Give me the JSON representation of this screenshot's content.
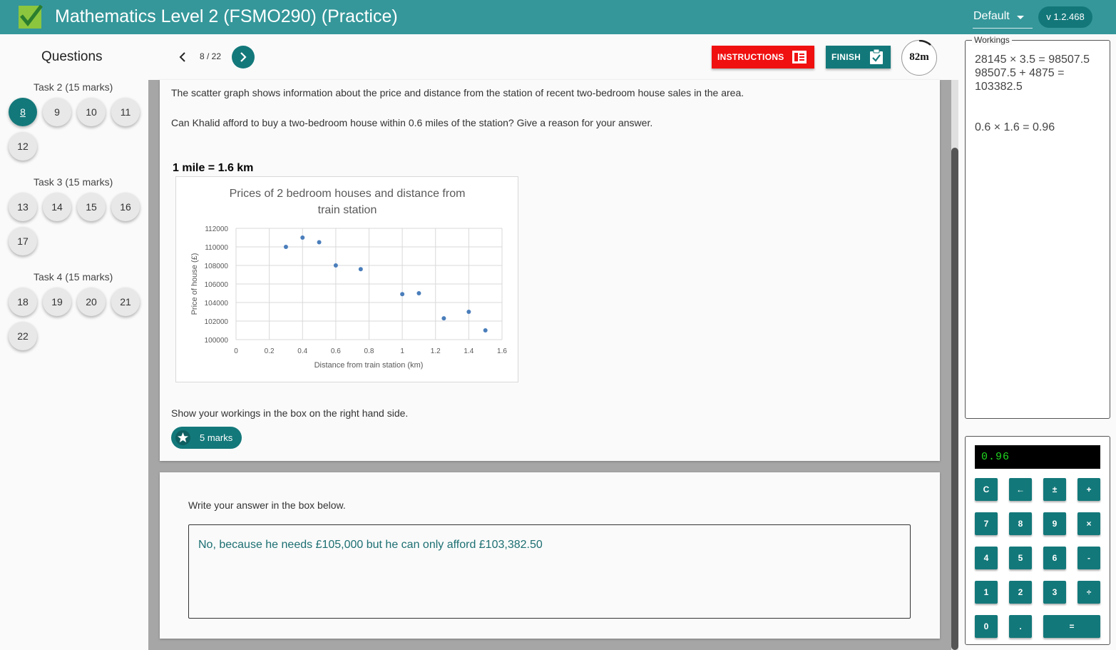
{
  "header": {
    "title": "Mathematics Level 2 (FSMO290) (Practice)",
    "theme": "Default",
    "version": "v 1.2.468"
  },
  "sidebar": {
    "title": "Questions",
    "tasks": [
      {
        "label": "Task 2 (15 marks)",
        "questions": [
          "8",
          "9",
          "10",
          "11",
          "12"
        ]
      },
      {
        "label": "Task 3 (15 marks)",
        "questions": [
          "13",
          "14",
          "15",
          "16",
          "17"
        ]
      },
      {
        "label": "Task 4 (15 marks)",
        "questions": [
          "18",
          "19",
          "20",
          "21",
          "22"
        ]
      }
    ],
    "active_question": "8"
  },
  "nav": {
    "count": "8 / 22",
    "instructions_label": "INSTRUCTIONS",
    "finish_label": "FINISH",
    "timer": "82m"
  },
  "question": {
    "intro": "The scatter graph shows information about the price and distance from the station of recent two-bedroom house sales in the area.",
    "prompt": "Can Khalid afford to buy a two-bedroom house within 0.6 miles of the station? Give a reason for your answer.",
    "conversion_note": "1 mile = 1.6 km",
    "workings_instruction": "Show your workings in the box on the right hand side.",
    "marks": "5 marks"
  },
  "chart_data": {
    "type": "scatter",
    "title": "Prices of 2 bedroom houses and distance from train station",
    "title_lines": [
      "Prices of 2 bedroom houses and distance from",
      "train station"
    ],
    "xlabel": "Distance from train station (km)",
    "ylabel": "Price of house (£)",
    "xlim": [
      0,
      1.6
    ],
    "ylim": [
      100000,
      112000
    ],
    "x_ticks": [
      "0",
      "0.2",
      "0.4",
      "0.6",
      "0.8",
      "1",
      "1.2",
      "1.4",
      "1.6"
    ],
    "y_ticks": [
      "100000",
      "102000",
      "104000",
      "106000",
      "108000",
      "110000",
      "112000"
    ],
    "grid": true,
    "color": "#4a7ebb",
    "points": [
      {
        "x": 0.3,
        "y": 110000
      },
      {
        "x": 0.4,
        "y": 111000
      },
      {
        "x": 0.5,
        "y": 110500
      },
      {
        "x": 0.6,
        "y": 108000
      },
      {
        "x": 0.75,
        "y": 107600
      },
      {
        "x": 1.0,
        "y": 104900
      },
      {
        "x": 1.1,
        "y": 105000
      },
      {
        "x": 1.25,
        "y": 102300
      },
      {
        "x": 1.4,
        "y": 103000
      },
      {
        "x": 1.5,
        "y": 101000
      }
    ]
  },
  "answer": {
    "instruction": "Write your answer in the box below.",
    "text": "No, because he needs £105,000 but he can only afford £103,382.50"
  },
  "workings": {
    "legend": "Workings",
    "lines": [
      "28145 × 3.5 = 98507.5",
      "98507.5 + 4875 =",
      "103382.5",
      "0.6 × 1.6 = 0.96"
    ]
  },
  "calculator": {
    "display": "0.96",
    "keys": {
      "clear": "C",
      "back": "←",
      "sign": "±",
      "plus": "+",
      "seven": "7",
      "eight": "8",
      "nine": "9",
      "times": "×",
      "four": "4",
      "five": "5",
      "six": "6",
      "minus": "-",
      "one": "1",
      "two": "2",
      "three": "3",
      "divide": "÷",
      "zero": "0",
      "dot": ".",
      "equals": "="
    }
  },
  "colors": {
    "primary": "#35979a",
    "accent": "#13787a",
    "danger": "#f01010",
    "logo": "#8cc63f"
  }
}
